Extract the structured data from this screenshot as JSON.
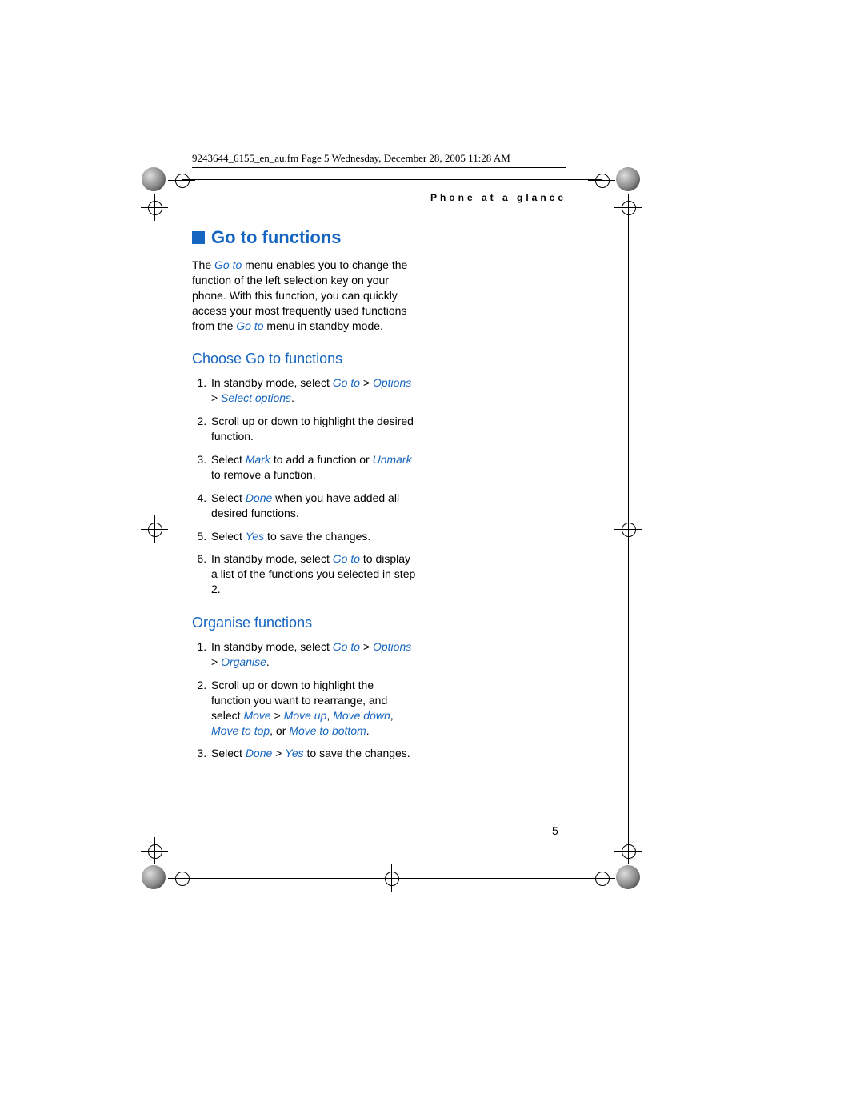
{
  "fm_header": "9243644_6155_en_au.fm  Page 5  Wednesday, December 28, 2005  11:28 AM",
  "section_label": "Phone at a glance",
  "heading_main": "Go to functions",
  "intro": {
    "p1a": "The ",
    "p1b": "Go to",
    "p1c": " menu enables you to change the function of the left selection key on your phone. With this function, you can quickly access your most frequently used functions from the ",
    "p1d": "Go to",
    "p1e": " menu in standby mode."
  },
  "sub1": "Choose Go to functions",
  "list1": {
    "i1a": "In standby mode, select ",
    "i1b": "Go to",
    "i1c": " > ",
    "i1d": "Options",
    "i1e": " > ",
    "i1f": "Select options",
    "i1g": ".",
    "i2": "Scroll up or down to highlight the desired function.",
    "i3a": "Select ",
    "i3b": "Mark",
    "i3c": " to add a function or ",
    "i3d": "Unmark",
    "i3e": " to remove a function.",
    "i4a": "Select ",
    "i4b": "Done",
    "i4c": " when you have added all desired functions.",
    "i5a": "Select ",
    "i5b": "Yes",
    "i5c": " to save the changes.",
    "i6a": "In standby mode, select ",
    "i6b": "Go to",
    "i6c": " to display a list of the functions you selected in step 2."
  },
  "sub2": "Organise functions",
  "list2": {
    "i1a": "In standby mode, select ",
    "i1b": "Go to",
    "i1c": " > ",
    "i1d": "Options",
    "i1e": " > ",
    "i1f": "Organise",
    "i1g": ".",
    "i2a": "Scroll up or down to highlight the function you want to rearrange, and select ",
    "i2b": "Move",
    "i2c": " > ",
    "i2d": "Move up",
    "i2e": ", ",
    "i2f": "Move down",
    "i2g": ", ",
    "i2h": "Move to top",
    "i2i": ", or ",
    "i2j": "Move to bottom",
    "i2k": ".",
    "i3a": "Select ",
    "i3b": "Done",
    "i3c": " > ",
    "i3d": "Yes",
    "i3e": " to save the changes."
  },
  "page_number": "5"
}
